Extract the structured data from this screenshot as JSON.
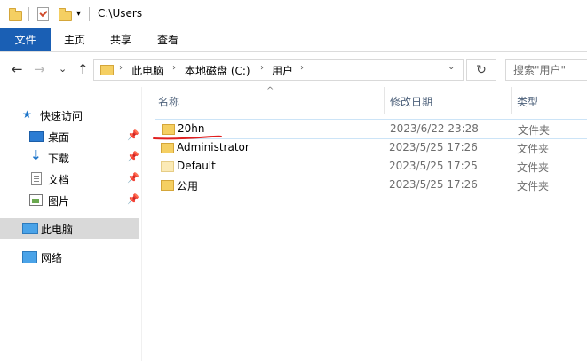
{
  "window": {
    "title": "C:\\Users"
  },
  "ribbon": {
    "tabs": [
      "文件",
      "主页",
      "共享",
      "查看"
    ]
  },
  "nav_buttons": {
    "back": "←",
    "forward": "→",
    "recent": "⌄",
    "up": "↑"
  },
  "address": {
    "breadcrumbs": [
      "此电脑",
      "本地磁盘 (C:)",
      "用户"
    ],
    "separator": "›",
    "dropdown": "⌄",
    "refresh": "↻"
  },
  "search": {
    "placeholder": "搜索\"用户\""
  },
  "sidebar": {
    "quick_access": "快速访问",
    "pinned": [
      "桌面",
      "下载",
      "文档",
      "图片"
    ],
    "pin_glyph": "📌",
    "this_pc": "此电脑",
    "network": "网络"
  },
  "columns": {
    "name": "名称",
    "modified": "修改日期",
    "type": "类型",
    "sort_glyph": "^"
  },
  "files": [
    {
      "name": "20hn",
      "modified": "2023/6/22 23:28",
      "type": "文件夹"
    },
    {
      "name": "Administrator",
      "modified": "2023/5/25 17:26",
      "type": "文件夹"
    },
    {
      "name": "Default",
      "modified": "2023/5/25 17:25",
      "type": "文件夹"
    },
    {
      "name": "公用",
      "modified": "2023/5/25 17:26",
      "type": "文件夹"
    }
  ],
  "colors": {
    "file_tab": "#1a5fb4",
    "folder": "#f5cf62",
    "annotation": "#e02020",
    "selected_nav": "#d9d9d9"
  }
}
